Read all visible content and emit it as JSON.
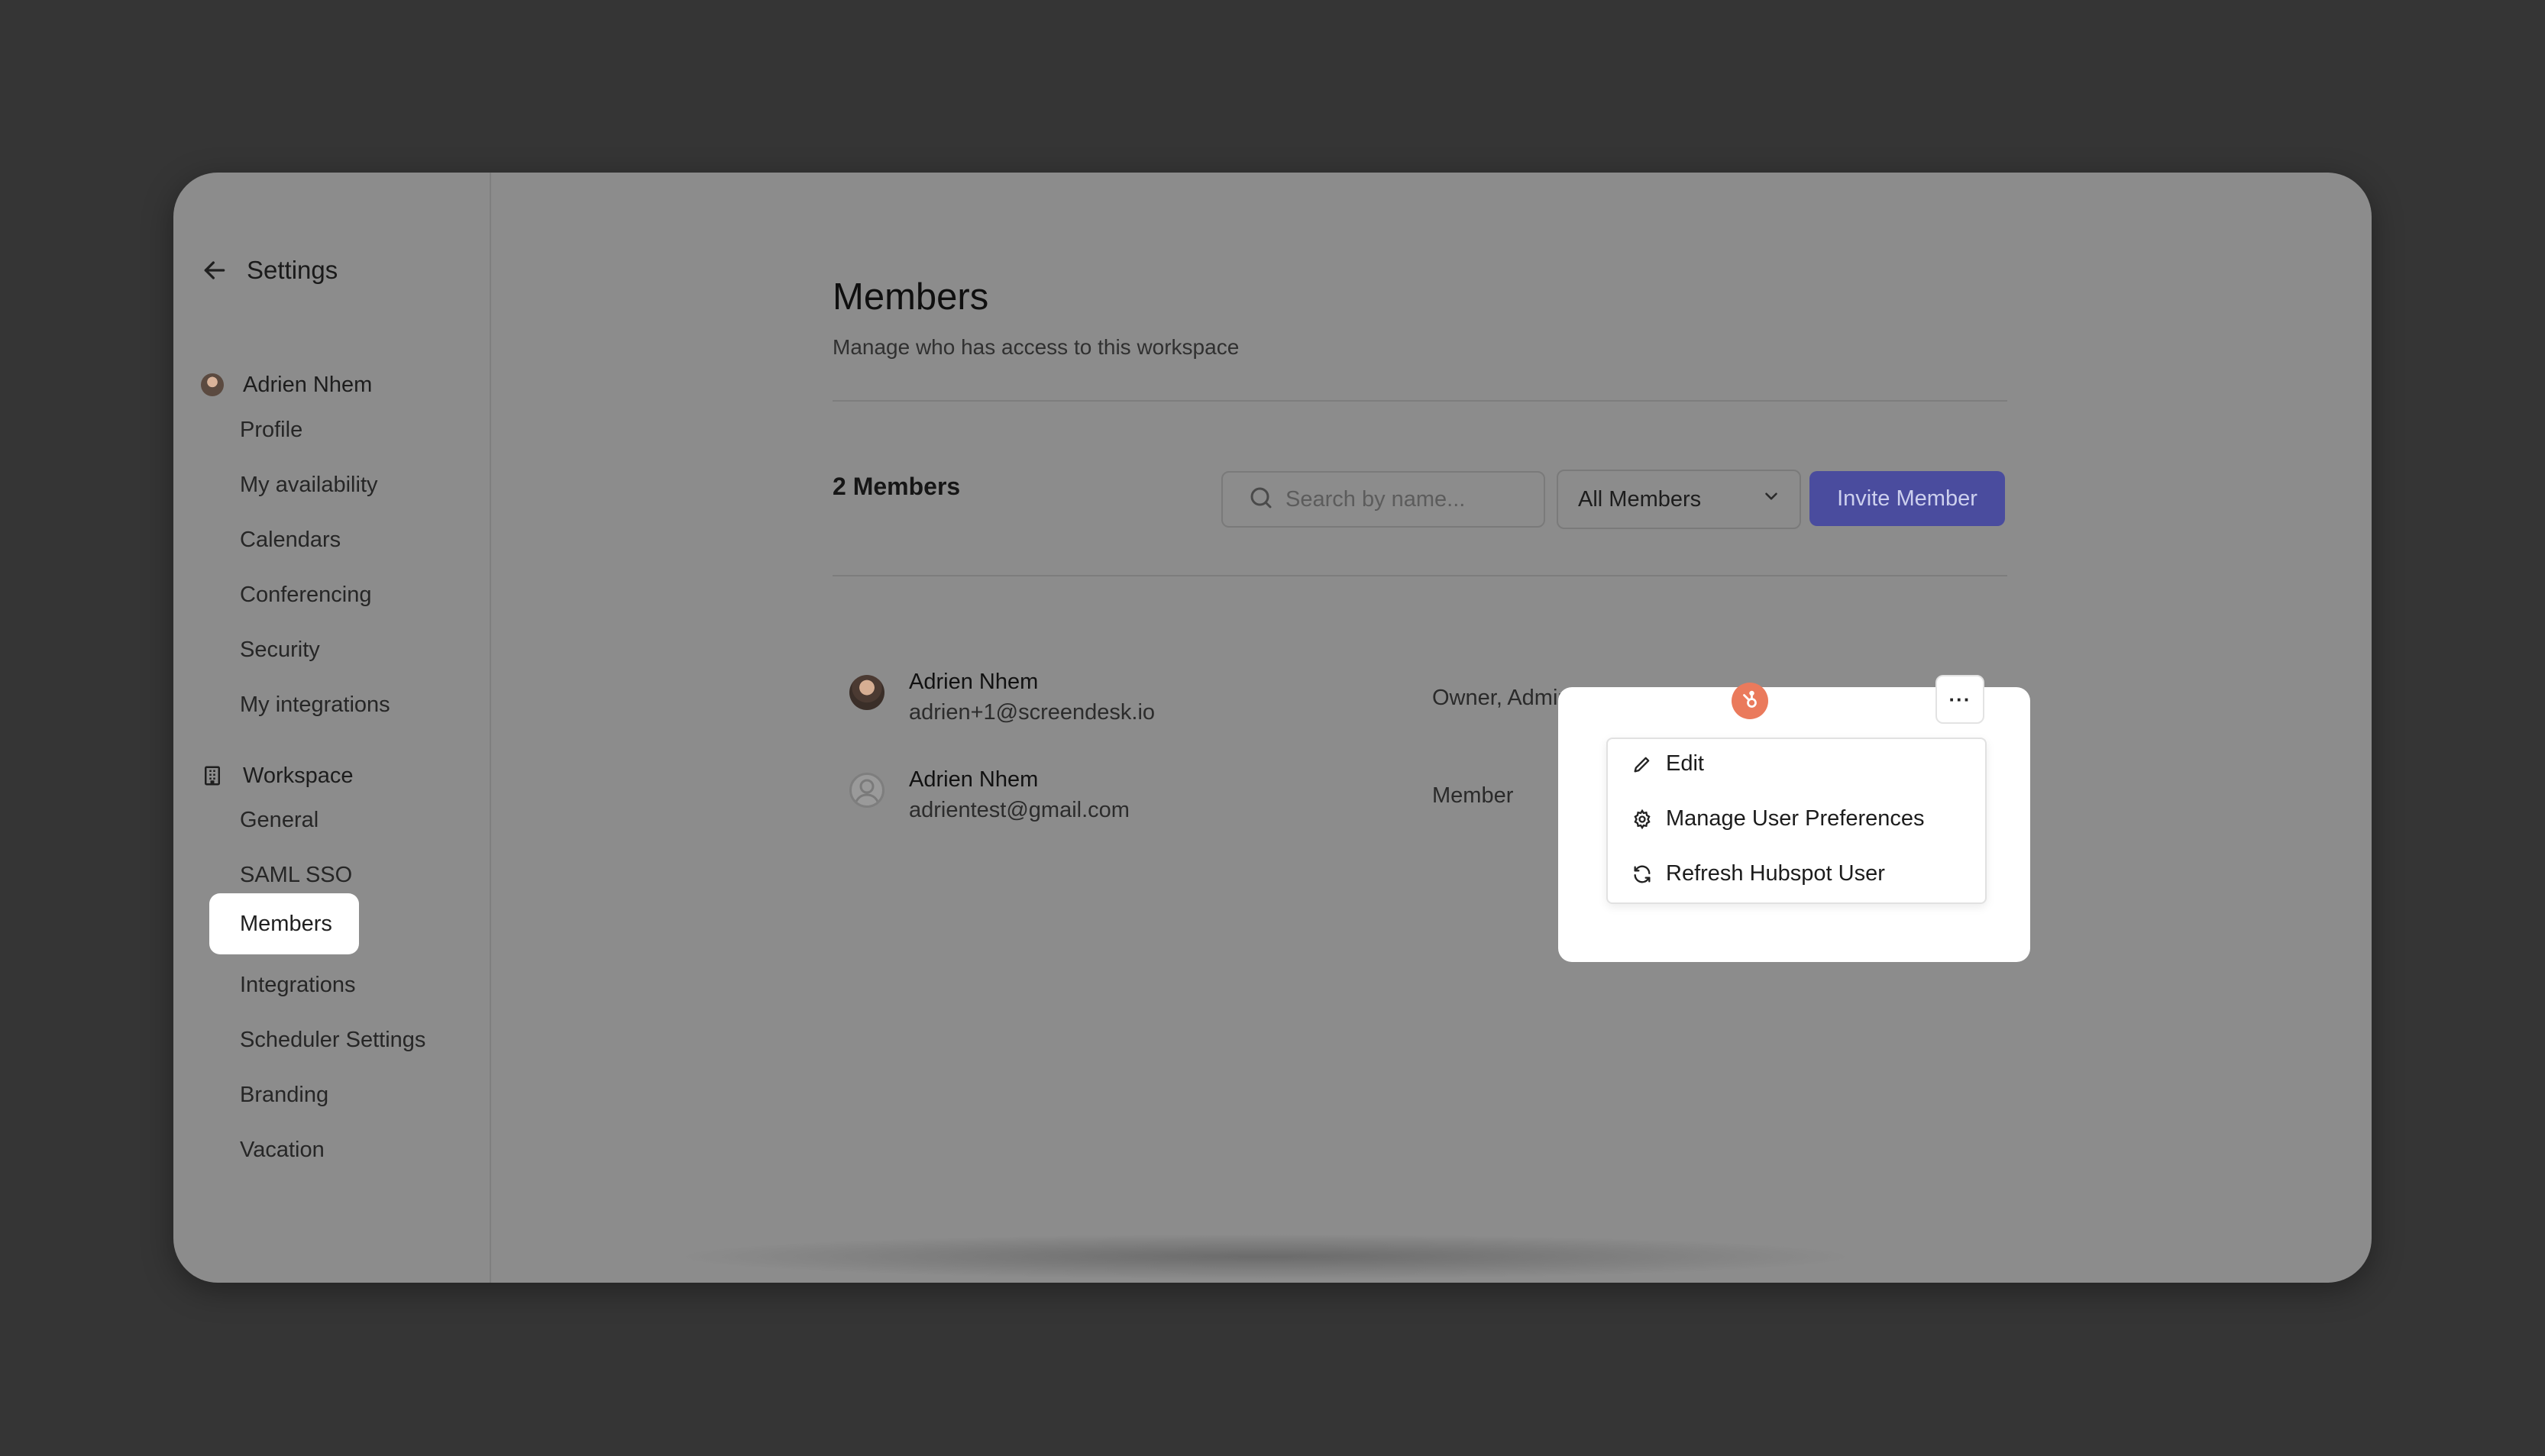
{
  "sidebar": {
    "title": "Settings",
    "user_section": {
      "name": "Adrien Nhem",
      "items": [
        "Profile",
        "My availability",
        "Calendars",
        "Conferencing",
        "Security",
        "My integrations"
      ]
    },
    "workspace_section": {
      "name": "Workspace",
      "items": [
        "General",
        "SAML SSO",
        "Members",
        "Integrations",
        "Scheduler Settings",
        "Branding",
        "Vacation"
      ],
      "active": "Members"
    }
  },
  "main": {
    "title": "Members",
    "subtitle": "Manage who has access to this workspace",
    "count_label": "2 Members",
    "search": {
      "placeholder": "Search by name..."
    },
    "filter": {
      "selected": "All Members"
    },
    "invite_label": "Invite Member",
    "members": [
      {
        "name": "Adrien Nhem",
        "email": "adrien+1@screendesk.io",
        "role": "Owner, Admin"
      },
      {
        "name": "Adrien Nhem",
        "email": "adrientest@gmail.com",
        "role": "Member"
      }
    ]
  },
  "popup": {
    "more_button": "···",
    "menu": [
      {
        "label": "Edit",
        "icon": "pencil-icon"
      },
      {
        "label": "Manage User Preferences",
        "icon": "gear-icon"
      },
      {
        "label": "Refresh Hubspot User",
        "icon": "refresh-icon"
      }
    ]
  },
  "colors": {
    "backdrop": "#353535",
    "window_overlay": "#8c8c8c",
    "accent": "#4a4c9e",
    "hubspot": "#ea7a5c"
  }
}
